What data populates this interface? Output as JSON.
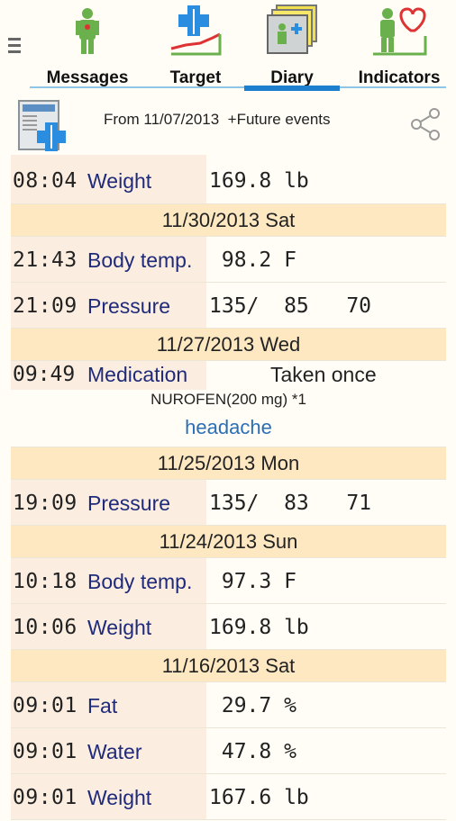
{
  "tabs": [
    {
      "label": "Messages",
      "icon": "person-icon"
    },
    {
      "label": "Target",
      "icon": "medical-target-icon"
    },
    {
      "label": "Diary",
      "icon": "diary-cards-icon"
    },
    {
      "label": "Indicators",
      "icon": "person-heart-icon"
    }
  ],
  "active_tab": "Diary",
  "header": {
    "text": "From 11/07/2013  +Future events",
    "icon": "newsletter-icon",
    "share_icon": "share-icon"
  },
  "entries": {
    "e1": {
      "time": "08:04",
      "kind": "Weight",
      "value": "169.8 lb"
    },
    "d1": "11/30/2013 Sat",
    "e2": {
      "time": "21:43",
      "kind": "Body temp.",
      "value": " 98.2 F"
    },
    "e3": {
      "time": "21:09",
      "kind": "Pressure",
      "value": "135/  85   70"
    },
    "d2": "11/27/2013 Wed",
    "e4": {
      "time": "09:49",
      "kind": "Medication",
      "taken": "Taken once",
      "drug": "NUROFEN(200 mg) *1",
      "note": "headache"
    },
    "d3": "11/25/2013 Mon",
    "e5": {
      "time": "19:09",
      "kind": "Pressure",
      "value": "135/  83   71"
    },
    "d4": "11/24/2013 Sun",
    "e6": {
      "time": "10:18",
      "kind": "Body temp.",
      "value": " 97.3 F"
    },
    "e7": {
      "time": "10:06",
      "kind": "Weight",
      "value": "169.8 lb"
    },
    "d5": "11/16/2013 Sat",
    "e8": {
      "time": "09:01",
      "kind": "Fat",
      "value": " 29.7 %"
    },
    "e9": {
      "time": "09:01",
      "kind": "Water",
      "value": " 47.8 %"
    },
    "e10": {
      "time": "09:01",
      "kind": "Weight",
      "value": "167.6 lb"
    }
  },
  "colors": {
    "accent": "#1e7fcf",
    "kind_text": "#1f2a7a",
    "day_header_bg": "#fde8c2",
    "time_bg": "#fbeee0",
    "note_text": "#2a6fb6"
  }
}
